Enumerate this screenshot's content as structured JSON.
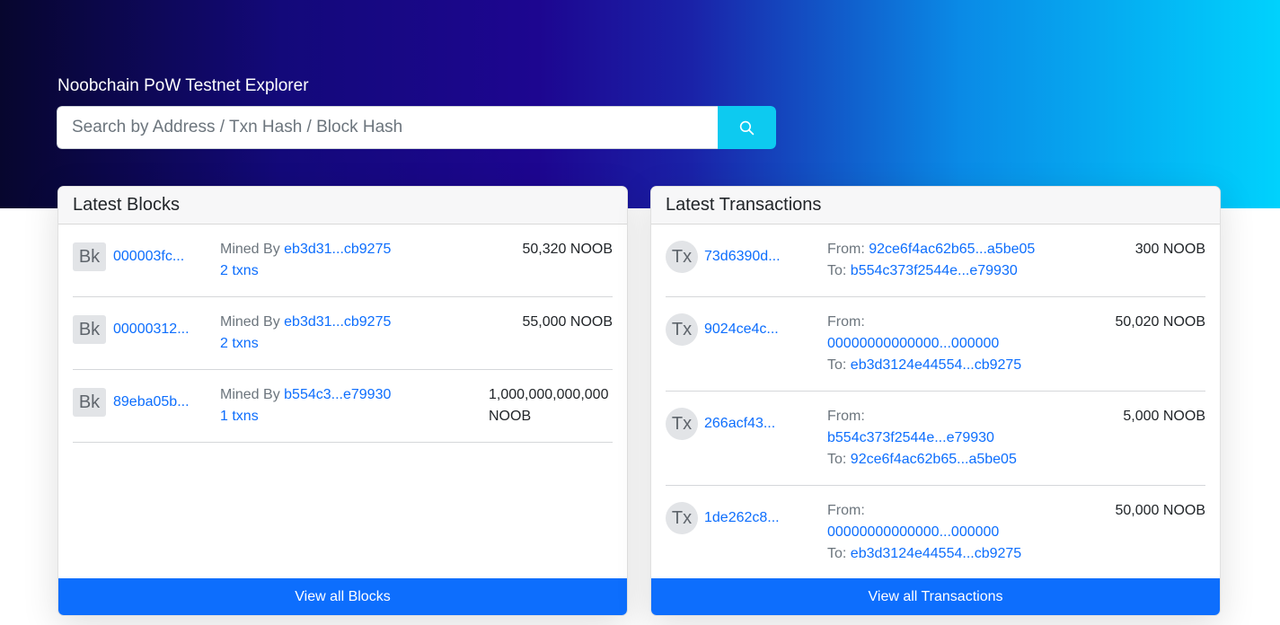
{
  "header": {
    "title": "Noobchain PoW Testnet Explorer",
    "search_placeholder": "Search by Address / Txn Hash / Block Hash",
    "search_icon": "search-icon"
  },
  "blocks": {
    "title": "Latest Blocks",
    "footer_label": "View all Blocks",
    "mined_by_label": "Mined By",
    "items": [
      {
        "badge": "Bk",
        "hash": "000003fc...",
        "miner": "eb3d31...cb9275",
        "txns": "2 txns",
        "value": "50,320 NOOB"
      },
      {
        "badge": "Bk",
        "hash": "00000312...",
        "miner": "eb3d31...cb9275",
        "txns": "2 txns",
        "value": "55,000 NOOB"
      },
      {
        "badge": "Bk",
        "hash": "89eba05b...",
        "miner": "b554c3...e79930",
        "txns": "1 txns",
        "value": "1,000,000,000,000 NOOB"
      }
    ]
  },
  "transactions": {
    "title": "Latest Transactions",
    "footer_label": "View all Transactions",
    "from_label": "From:",
    "to_label": "To:",
    "items": [
      {
        "badge": "Tx",
        "hash": "73d6390d...",
        "from": "92ce6f4ac62b65...a5be05",
        "to": "b554c373f2544e...e79930",
        "value": "300 NOOB"
      },
      {
        "badge": "Tx",
        "hash": "9024ce4c...",
        "from": "00000000000000...000000",
        "to": "eb3d3124e44554...cb9275",
        "value": "50,020 NOOB"
      },
      {
        "badge": "Tx",
        "hash": "266acf43...",
        "from": "b554c373f2544e...e79930",
        "to": "92ce6f4ac62b65...a5be05",
        "value": "5,000 NOOB"
      },
      {
        "badge": "Tx",
        "hash": "1de262c8...",
        "from": "00000000000000...000000",
        "to": "eb3d3124e44554...cb9275",
        "value": "50,000 NOOB"
      }
    ]
  }
}
